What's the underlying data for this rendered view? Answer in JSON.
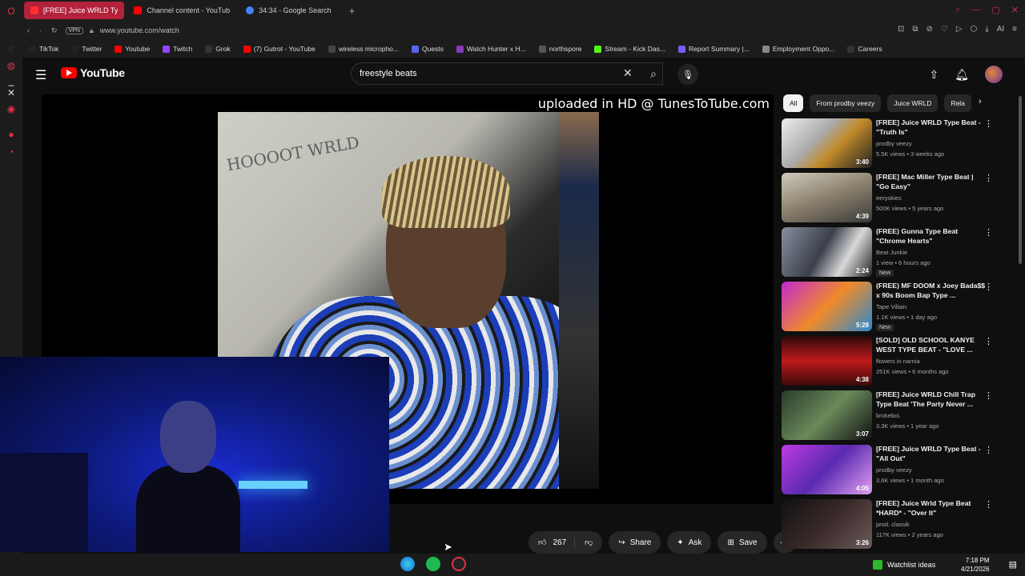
{
  "browser": {
    "tabs": [
      {
        "label": "[FREE] Juice WRLD Ty",
        "color": "#ff0000"
      },
      {
        "label": "Channel content - YouTub",
        "color": "#ff0000"
      },
      {
        "label": "34:34 - Google Search",
        "color": "#4285f4"
      }
    ],
    "new_tab": "+",
    "url": "www.youtube.com/watch",
    "vpn": "VPN",
    "bookmarks": [
      {
        "label": "TikTok",
        "color": "#222"
      },
      {
        "label": "Twitter",
        "color": "#222"
      },
      {
        "label": "Youtube",
        "color": "#ff0000"
      },
      {
        "label": "Twitch",
        "color": "#9146ff"
      },
      {
        "label": "Grok",
        "color": "#333"
      },
      {
        "label": "(7) Gutrot - YouTube",
        "color": "#ff0000"
      },
      {
        "label": "wireless micropho...",
        "color": "#444"
      },
      {
        "label": "Quests",
        "color": "#5865f2"
      },
      {
        "label": "Watch Hunter x H...",
        "color": "#8a3ab9"
      },
      {
        "label": "northspore",
        "color": "#555"
      },
      {
        "label": "Stream - Kick Das...",
        "color": "#53fc18"
      },
      {
        "label": "Report Summary |...",
        "color": "#7a5cff"
      },
      {
        "label": "Employment Oppo...",
        "color": "#888"
      },
      {
        "label": "Careers",
        "color": "#333"
      }
    ]
  },
  "youtube": {
    "logo": "YouTube",
    "search_query": "freestyle beats",
    "watermark": "uploaded in HD @ TunesToTube.com",
    "wall_text": "HOOOOT WRLD",
    "like_count": "267",
    "share_label": "Share",
    "ask_label": "Ask",
    "save_label": "Save",
    "chips": [
      "All",
      "From prodby veezy",
      "Juice WRLD",
      "Rela"
    ],
    "recommendations": [
      {
        "title": "[FREE] Juice WRLD Type Beat - \"Truth Is\"",
        "channel": "prodby veezy",
        "meta": "5.5K views • 3 weeks ago",
        "duration": "3:40",
        "new": "",
        "thumb": "linear-gradient(135deg,#eee,#aaa 40%,#c08a2a 60%,#222)"
      },
      {
        "title": "[FREE] Mac Miller Type Beat | \"Go Easy\"",
        "channel": "eeryskies",
        "meta": "500K views • 5 years ago",
        "duration": "4:39",
        "new": "",
        "thumb": "linear-gradient(160deg,#cfcabc,#8a7f6c 50%,#3a3a3a)"
      },
      {
        "title": "(FREE) Gunna Type Beat \"Chrome Hearts\"",
        "channel": "Beat Junkie",
        "meta": "1 view • 6 hours ago",
        "duration": "2:24",
        "new": "New",
        "thumb": "linear-gradient(120deg,#8a8fa0,#3a3f4a 45%,#d8d8d8 70%,#222)"
      },
      {
        "title": "(FREE) MF DOOM x Joey Bada$$ x 90s Boom Bap Type ...",
        "channel": "Tape Villain",
        "meta": "1.1K views • 1 day ago",
        "duration": "5:28",
        "new": "New",
        "thumb": "linear-gradient(135deg,#c02ad0,#f08a2a 50%,#2a8ad0)"
      },
      {
        "title": "[SOLD] OLD SCHOOL KANYE WEST TYPE BEAT - \"LOVE ...",
        "channel": "flowers in narnia",
        "meta": "251K views • 6 months ago",
        "duration": "4:38",
        "new": "",
        "thumb": "linear-gradient(180deg,#2a0a0a,#c01a1a 50%,#3a0a0a)"
      },
      {
        "title": "[FREE] Juice WRLD Chill Trap Type Beat 'The Party Never ...",
        "channel": "brokeboi.",
        "meta": "3.3K views • 1 year ago",
        "duration": "3:07",
        "new": "",
        "thumb": "linear-gradient(135deg,#2a3a2a,#6a8a5a 50%,#111)"
      },
      {
        "title": "[FREE] Juice WRLD Type Beat - \"All Out\"",
        "channel": "prodby veezy",
        "meta": "3.6K views • 1 month ago",
        "duration": "4:05",
        "new": "",
        "thumb": "linear-gradient(135deg,#c03ae0,#5a2ab0 50%,#e0a0f0)"
      },
      {
        "title": "[FREE] Juice Wrld Type Beat *HARD* - \"Over It\"",
        "channel": "prod. classik",
        "meta": "117K views • 2 years ago",
        "duration": "3:26",
        "new": "",
        "thumb": "linear-gradient(135deg,#111,#3a2a2a 50%,#6a5a5a)"
      }
    ]
  },
  "taskbar": {
    "watchlist": "Watchlist ideas",
    "time": "7:18 PM",
    "date": "4/21/2026"
  }
}
